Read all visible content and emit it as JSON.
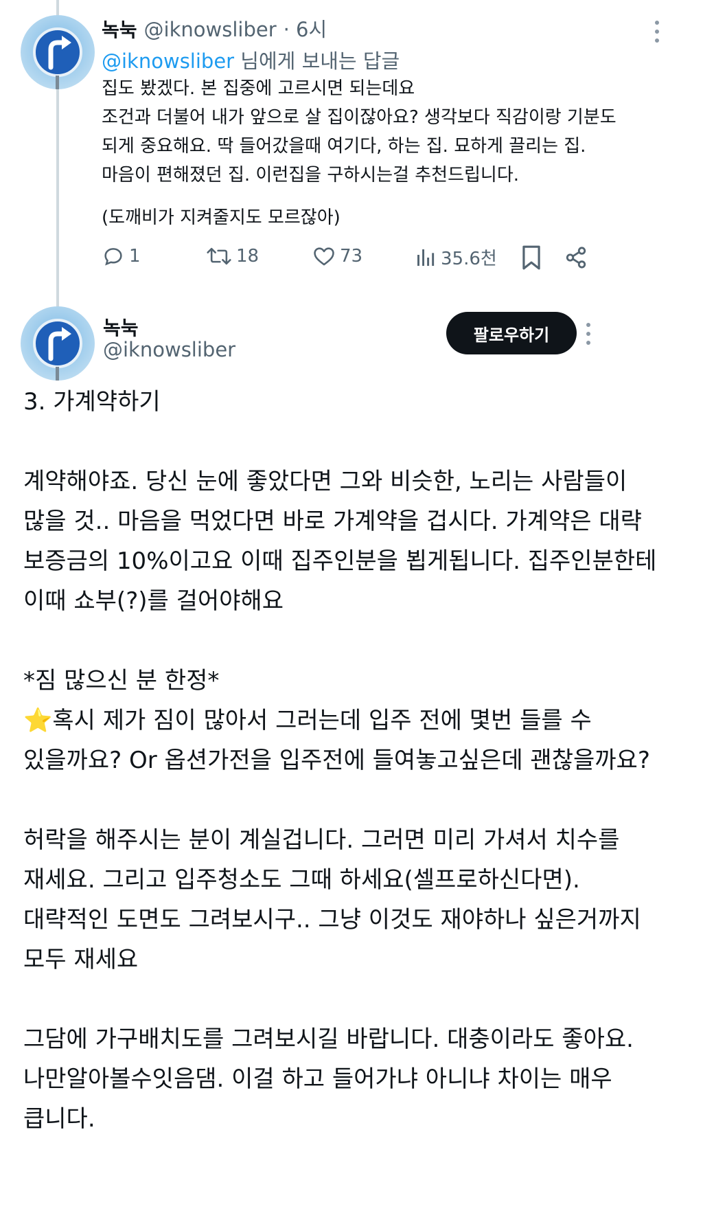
{
  "reply_tweet": {
    "author_name": "녹눅",
    "author_handle": "@iknowsliber",
    "time": "· 6시",
    "reply_mention": "@iknowsliber",
    "reply_suffix": " 님에게 보내는 답글",
    "text": "집도 봤겠다. 본 집중에 고르시면 되는데요\n조건과 더불어 내가 앞으로 살 집이잖아요? 생각보다 직감이랑 기분도\n되게 중요해요. 딱 들어갔을때 여기다, 하는 집. 묘하게 끌리는 집.\n마음이 편해졌던 집. 이런집을 구하시는걸 추천드립니다.",
    "text2": "(도깨비가 지켜줄지도 모르잖아)",
    "stats": {
      "replies": "1",
      "retweets": "18",
      "likes": "73",
      "views": "35.6천"
    }
  },
  "main_tweet": {
    "author_name": "녹눅",
    "author_handle": "@iknowsliber",
    "follow_label": "팔로우하기",
    "heading": "3. 가계약하기",
    "p1": "계약해야죠. 당신 눈에 좋았다면 그와 비슷한, 노리는 사람들이\n많을 것.. 마음을 먹었다면 바로 가계약을 겁시다. 가계약은 대략\n보증금의 10%이고요 이때 집주인분을 뵙게됩니다. 집주인분한테\n이때 쇼부(?)를 걸어야해요",
    "p2_title": "*짐 많으신 분 한정*",
    "p2_star": "⭐",
    "p2_body": "혹시 제가 짐이 많아서 그러는데 입주 전에 몇번 들를 수\n있을까요? Or 옵션가전을 입주전에 들여놓고싶은데 괜찮을까요?",
    "p3": "허락을 해주시는 분이 계실겁니다. 그러면 미리 가셔서 치수를\n재세요. 그리고 입주청소도 그때 하세요(셀프로하신다면).\n대략적인 도면도 그려보시구.. 그냥 이것도 재야하나 싶은거까지\n모두 재세요",
    "p4": "그담에 가구배치도를 그려보시길 바랍니다. 대충이라도 좋아요.\n나만알아볼수잇음댐. 이걸 하고 들어가냐 아니냐 차이는 매우\n큽니다."
  },
  "colors": {
    "text": "#0f1419",
    "secondary": "#536471",
    "link": "#1d9bf0",
    "thread_line": "#cfd9de",
    "follow_bg": "#0f1419"
  }
}
